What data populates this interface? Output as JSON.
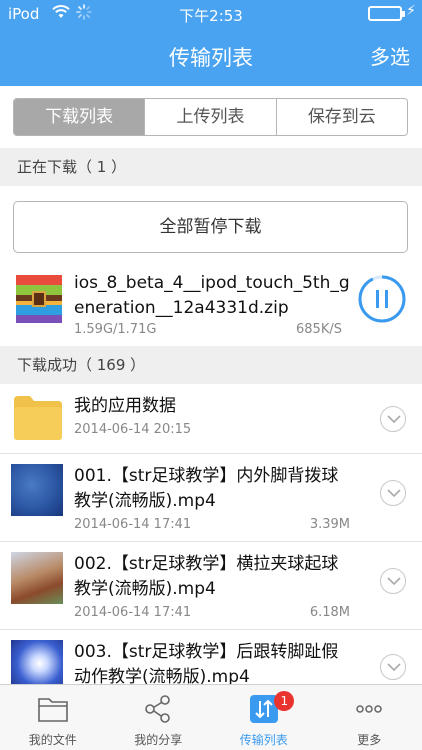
{
  "status_bar": {
    "carrier": "iPod",
    "time": "下午2:53"
  },
  "nav": {
    "title": "传输列表",
    "multi_select": "多选"
  },
  "segments": [
    {
      "label": "下载列表",
      "active": true
    },
    {
      "label": "上传列表",
      "active": false
    },
    {
      "label": "保存到云",
      "active": false
    }
  ],
  "downloading": {
    "header": "正在下载（ 1 ）",
    "pause_all": "全部暂停下载",
    "item": {
      "name": "ios_8_beta_4__ipod_touch_5th_generation__12a4331d.zip",
      "size": "1.59G/1.71G",
      "speed": "685K/S",
      "progress": 0.93
    }
  },
  "completed": {
    "header": "下载成功（ 169 ）",
    "items": [
      {
        "name": "我的应用数据",
        "date": "2014-06-14 20:15",
        "size": "",
        "icon": "folder-icon"
      },
      {
        "name": "001.【str足球教学】内外脚背拨球教学(流畅版).mp4",
        "date": "2014-06-14 17:41",
        "size": "3.39M",
        "icon": "video-thumbnail"
      },
      {
        "name": "002.【str足球教学】横拉夹球起球教学(流畅版).mp4",
        "date": "2014-06-14 17:41",
        "size": "6.18M",
        "icon": "video-thumbnail"
      },
      {
        "name": "003.【str足球教学】后跟转脚趾假动作教学(流畅版).mp4",
        "date": "",
        "size": "",
        "icon": "video-thumbnail"
      }
    ]
  },
  "tabs": [
    {
      "label": "我的文件",
      "icon": "folder-outline-icon",
      "active": false
    },
    {
      "label": "我的分享",
      "icon": "share-icon",
      "active": false
    },
    {
      "label": "传输列表",
      "icon": "transfer-icon",
      "active": true,
      "badge": "1"
    },
    {
      "label": "更多",
      "icon": "more-icon",
      "active": false
    }
  ],
  "colors": {
    "accent": "#4aa3f0",
    "badge": "#e8332f",
    "segment_active": "#a8a8a8"
  }
}
